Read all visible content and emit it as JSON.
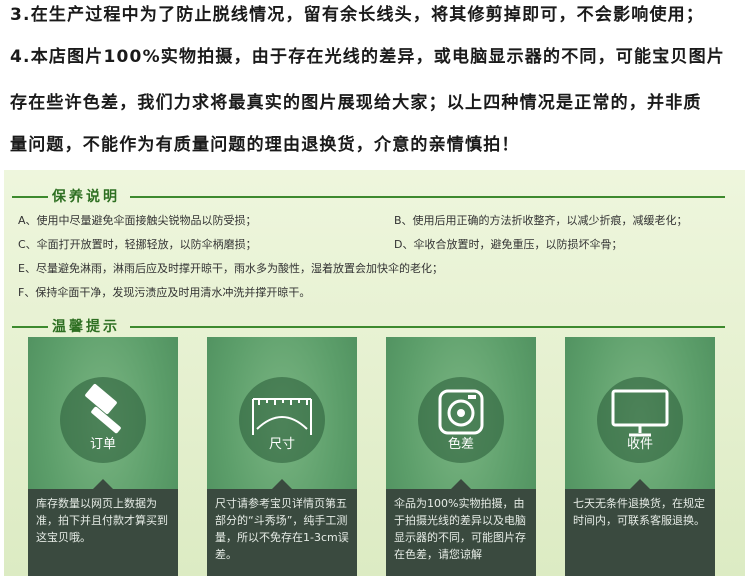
{
  "notes": [
    {
      "num": "3.",
      "text": "在生产过程中为了防止脱线情况，留有余长线头，将其修剪掉即可，不会影响使用；"
    },
    {
      "num": "4.",
      "text": "本店图片100%实物拍摄，由于存在光线的差异，或电脑显示器的不同，可能宝贝图片"
    },
    {
      "num": "",
      "text": "存在些许色差，我们力求将最真实的图片展现给大家；以上四种情况是正常的，并非质"
    },
    {
      "num": "",
      "text": "量问题，不能作为有质量问题的理由退换货，介意的亲情慎拍！"
    }
  ],
  "care": {
    "title": "保养说明",
    "items": [
      "A、使用中尽量避免伞面接触尖锐物品以防受损；",
      "B、使用后用正确的方法折收整齐，以减少折痕，减缓老化；",
      "C、伞面打开放置时，轻挪轻放，以防伞柄磨损；",
      "D、伞收合放置时，避免重压，以防损坏伞骨；",
      "E、尽量避免淋雨，淋雨后应及时撑开晾干，雨水多为酸性，湿着放置会加快伞的老化；",
      "F、保持伞面干净，发现污渍应及时用清水冲洗并撑开晾干。"
    ]
  },
  "tips": {
    "title": "温馨提示",
    "cards": [
      {
        "icon": "hammer-icon",
        "label": "订单",
        "desc": "库存数量以网页上数据为准，拍下并且付款才算买到这宝贝哦。"
      },
      {
        "icon": "ruler-umbrella-icon",
        "label": "尺寸",
        "desc": "尺寸请参考宝贝详情页第五部分的“斗秀场”，纯手工测量，所以不免存在1-3cm误差。"
      },
      {
        "icon": "camera-icon",
        "label": "色差",
        "desc": "伞品为100%实物拍摄，由于拍摄光线的差异以及电脑显示器的不同，可能图片存在色差，请您谅解"
      },
      {
        "icon": "monitor-icon",
        "label": "收件",
        "desc": "七天无条件退换货，在规定时间内，可联系客服退换。"
      }
    ]
  }
}
